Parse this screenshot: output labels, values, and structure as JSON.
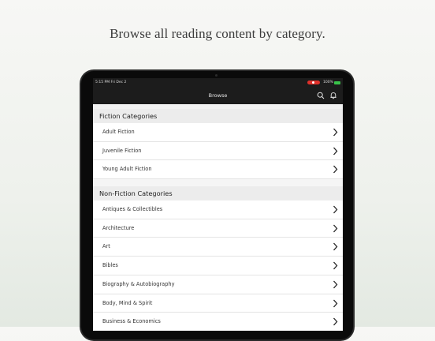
{
  "headline": "Browse all reading content by category.",
  "status_bar": {
    "time_date": "5:15 PM   Fri Dec 2",
    "battery": "100%"
  },
  "nav": {
    "title": "Browse",
    "icons": [
      "search-icon",
      "bell-icon"
    ]
  },
  "sections": [
    {
      "title": "Fiction Categories",
      "items": [
        "Adult Fiction",
        "Juvenile Fiction",
        "Young Adult Fiction"
      ]
    },
    {
      "title": "Non-Fiction Categories",
      "items": [
        "Antiques & Collectibles",
        "Architecture",
        "Art",
        "Bibles",
        "Biography & Autobiography",
        "Body, Mind & Spirit",
        "Business & Economics"
      ]
    }
  ],
  "colors": {
    "status_pill": "#e0302a",
    "battery": "#39c24a",
    "bar": "#1c1c1c"
  }
}
